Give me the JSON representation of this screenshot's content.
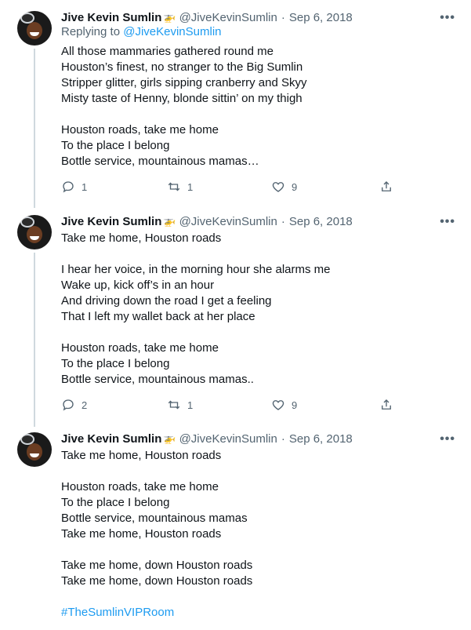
{
  "tweets": [
    {
      "name": "Jive Kevin Sumlin",
      "handle": "@JiveKevinSumlin",
      "date": "Sep 6, 2018",
      "reply_to_prefix": "Replying to",
      "reply_to_handle": "@JiveKevinSumlin",
      "lines": [
        "All those mammaries gathered round me",
        "Houston’s finest, no stranger to the Big Sumlin",
        "Stripper glitter, girls sipping cranberry and Skyy",
        "Misty taste of Henny, blonde sittin’ on my thigh",
        "",
        "Houston roads, take me home",
        "To the place I belong",
        "Bottle service, mountainous mamas…"
      ],
      "replies": "1",
      "retweets": "1",
      "likes": "9"
    },
    {
      "name": "Jive Kevin Sumlin",
      "handle": "@JiveKevinSumlin",
      "date": "Sep 6, 2018",
      "lines": [
        "Take me home, Houston roads",
        "",
        "I hear her voice, in the morning hour she alarms me",
        "Wake up, kick off’s in an hour",
        "And driving down the road I get a feeling",
        "That I left my wallet back at her place",
        "",
        "Houston roads, take me home",
        "To the place I belong",
        "Bottle service, mountainous mamas.."
      ],
      "replies": "2",
      "retweets": "1",
      "likes": "9"
    },
    {
      "name": "Jive Kevin Sumlin",
      "handle": "@JiveKevinSumlin",
      "date": "Sep 6, 2018",
      "lines": [
        "Take me home, Houston roads",
        "",
        "Houston roads, take me home",
        "To the place I belong",
        "Bottle service, mountainous mamas",
        "Take me home, Houston roads",
        "",
        "Take me home, down Houston roads",
        "Take me home, down Houston roads",
        ""
      ],
      "hashtag": "#TheSumlinVIPRoom"
    }
  ],
  "icons": {
    "verified_emoji": "helicopter-emoji",
    "more": "more-options-icon",
    "reply": "reply-icon",
    "retweet": "retweet-icon",
    "like": "like-icon",
    "share": "share-icon"
  },
  "colors": {
    "accent": "#1d9bf0",
    "muted": "#536471",
    "text": "#0f1419"
  },
  "more_glyph": "•••",
  "emoji_glyph": "🚁"
}
